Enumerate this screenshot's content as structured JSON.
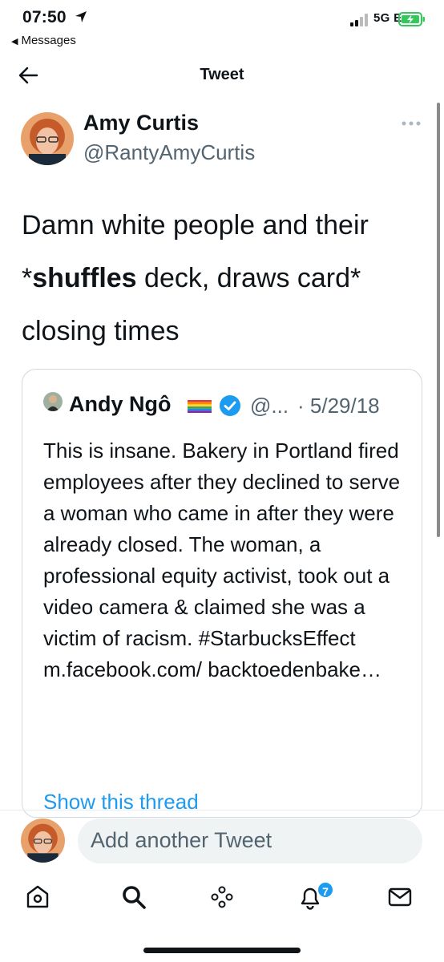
{
  "status_bar": {
    "time": "07:50",
    "back_app": "Messages",
    "network": "5G E"
  },
  "header": {
    "title": "Tweet"
  },
  "tweet": {
    "author_name": "Amy Curtis",
    "author_handle": "@RantyAmyCurtis",
    "text_line1": "Damn white people and their",
    "text_star_open": "*",
    "text_bold": "shuffles",
    "text_line2_rest": " deck, draws card*",
    "text_line3": "closing times"
  },
  "quoted_tweet": {
    "author_name": "Andy Ngô",
    "author_handle": "@...",
    "date": "· 5/29/18",
    "text": "This is insane. Bakery in Portland fired employees after they declined to serve a woman who came in after they were already closed. The woman, a professional equity activist, took out a video camera & claimed she was a victim of racism. #StarbucksEffect m.facebook.com/ backtoedenbake…",
    "show_thread": "Show this thread"
  },
  "composer": {
    "placeholder": "Add another Tweet"
  },
  "tab_bar": {
    "items": [
      {
        "icon": "home-icon"
      },
      {
        "icon": "search-icon"
      },
      {
        "icon": "spaces-icon"
      },
      {
        "icon": "notifications-icon",
        "badge": "7"
      },
      {
        "icon": "messages-icon"
      }
    ]
  },
  "colors": {
    "accent": "#1d9bf0",
    "secondary_text": "#536471",
    "primary_text": "#0f1419",
    "battery_green": "#34c759"
  }
}
